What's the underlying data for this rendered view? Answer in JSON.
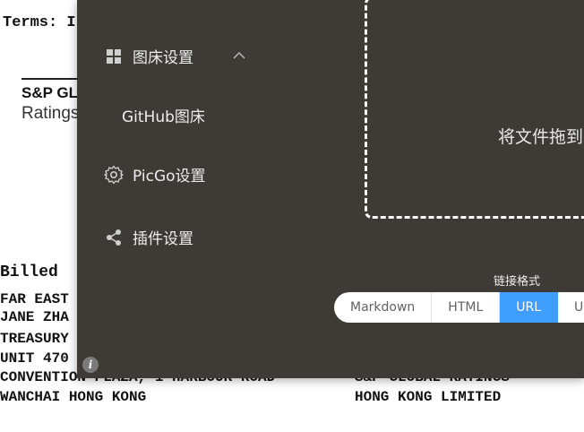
{
  "document": {
    "terms_label": "Terms: I",
    "logo_line1": "S&P GL",
    "logo_line2": "Ratings",
    "billed_label": "Billed",
    "left_lines": [
      "FAR EAST",
      "JANE ZHA",
      "TREASURY",
      "UNIT 470"
    ],
    "convention_line": "CONVENTION PLAZA, 1 HARBOUR ROAD",
    "wanchai_line": "WANCHAI HONG KONG",
    "right_line1": "S&P GLOBAL RATINGS",
    "right_line2": "HONG KONG LIMITED"
  },
  "sidebar": {
    "items": [
      {
        "label": "图床设置",
        "icon": "grid-icon"
      },
      {
        "label": "GitHub图床"
      },
      {
        "label": "PicGo设置",
        "icon": "gear-icon"
      },
      {
        "label": "插件设置",
        "icon": "share-icon"
      }
    ]
  },
  "upload": {
    "drop_text": "将文件拖到"
  },
  "link_format": {
    "label": "链接格式",
    "options": [
      "Markdown",
      "HTML",
      "URL",
      "U"
    ],
    "selected": "URL"
  },
  "colors": {
    "panel_bg": "#3e3a36",
    "accent": "#409eff"
  }
}
